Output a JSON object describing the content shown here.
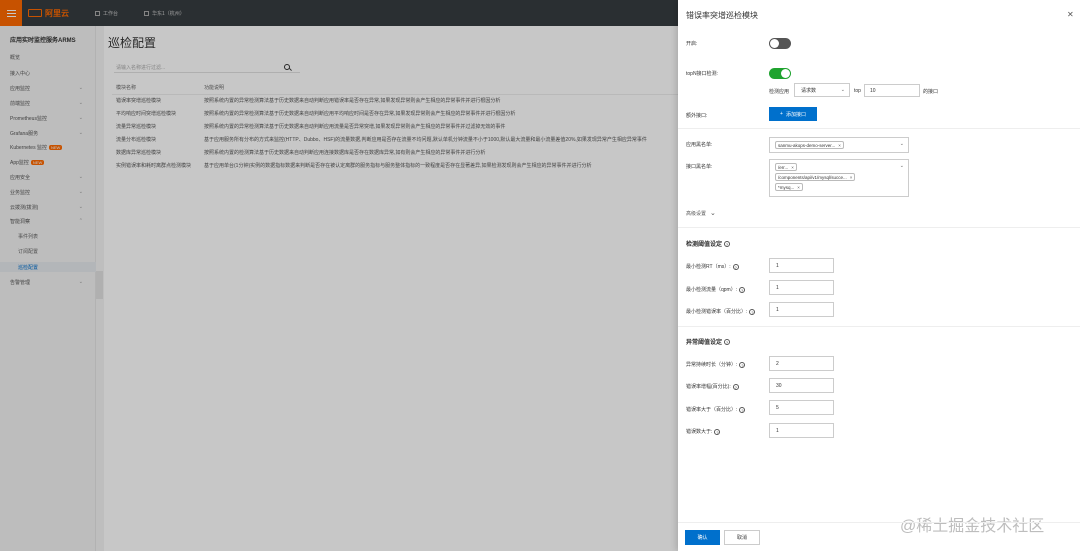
{
  "topbar": {
    "logo": "阿里云",
    "workbench": "工作台",
    "resource": "华东1（杭州）"
  },
  "sidebar": {
    "title": "应用实时监控服务ARMS",
    "items": [
      {
        "label": "概览"
      },
      {
        "label": "接入中心"
      },
      {
        "label": "应用监控"
      },
      {
        "label": "前端监控"
      },
      {
        "label": "Prometheus监控"
      },
      {
        "label": "Grafana服务"
      },
      {
        "label": "Kubernetes 监控",
        "badge": "NEW"
      },
      {
        "label": "App监控",
        "badge": "NEW"
      },
      {
        "label": "应用安全"
      },
      {
        "label": "业务监控"
      },
      {
        "label": "云拨测(拨测)"
      },
      {
        "label": "智能洞察"
      },
      {
        "label": "事件列表"
      },
      {
        "label": "订阅配置"
      },
      {
        "label": "巡检配置"
      },
      {
        "label": "告警管理"
      }
    ]
  },
  "main": {
    "title": "巡检配置",
    "search_placeholder": "请输入名称进行过滤...",
    "columns": [
      "模块名称",
      "功能说明"
    ],
    "rows": [
      {
        "name": "错误率突增巡检模块",
        "desc": "按照系统内置的异常检测算法基于历史数据来自动判断应用错误率是否存在异常,如果发现异常则会产生相应的异常事件并进行根因分析"
      },
      {
        "name": "平均响应时间突增巡检模块",
        "desc": "按照系统内置的异常检测算法基于历史数据来自动判断应用平均响应时间是否存在异常,如果发现异常则会产生相应的异常事件并进行根因分析"
      },
      {
        "name": "流量异常巡检模块",
        "desc": "按照系统内置的异常检测算法基于历史数据来自动判断应用流量是否异常突增,如果发现异常则会产生相应的异常事件并过滤掉无效的事件"
      },
      {
        "name": "流量分布巡检模块",
        "desc": "基于应用服务所有分布的方式来监控(HTTP、Dubbo、HSF)的流量数据,判断应用是否存在流量不均问题,默认单机分钟流量不小于1000,默认最大流量和最小流量差值20%,如果发现异常产生相应异常事件"
      },
      {
        "name": "数据库异常巡检模块",
        "desc": "按照系统内置的检测算法基于历史数据来自动判断应用连接数据库是否存在数据库异常,如有则会产生相应的异常事件并进行分析"
      },
      {
        "name": "实例错误率和耗时离群点检测模块",
        "desc": "基于应用单台(1分钟)实例的数据指标数据来判断是否存在被认定离群的服务指标与服务整体指标的一致程度是否存在显著差异,如果检测发现则会产生相应的异常事件并进行分析"
      }
    ]
  },
  "drawer": {
    "title": "错误率突增巡检模块",
    "enable_label": "开启:",
    "enable_on": false,
    "topn_label": "topN接口检测:",
    "topn_on": true,
    "detect_label": "检测应用",
    "detect_select": "请求数",
    "top_label": "top",
    "top_value": "10",
    "top_suffix": "的接口",
    "extra_label": "额外接口:",
    "add_button": "添加接口",
    "app_whitelist_label": "应用黑名单:",
    "app_tags": [
      "sanmu-akops-demo-server..."
    ],
    "api_whitelist_label": "接口黑名单:",
    "api_tags": [
      "/err...",
      "/components/api/v1/mysql/succe...",
      "*mysq..."
    ],
    "advanced": "高级设置",
    "detect_section": "检测阈值设定",
    "detect_fields": [
      {
        "label": "最小检测RT（ms）:",
        "value": "1"
      },
      {
        "label": "最小检测流量（qpm）:",
        "value": "1"
      },
      {
        "label": "最小检测错误率（百分比）:",
        "value": "1"
      }
    ],
    "anomaly_section": "异常阈值设定",
    "anomaly_fields": [
      {
        "label": "异常持续时长（分钟）:",
        "value": "2"
      },
      {
        "label": "错误率增幅(百分比):",
        "value": "30"
      },
      {
        "label": "错误率大于（百分比）:",
        "value": "5"
      },
      {
        "label": "错误数大于:",
        "value": "1"
      }
    ],
    "confirm": "确认",
    "cancel": "取消"
  },
  "watermark": "@稀土掘金技术社区",
  "colors": {
    "brand": "#ff6a00",
    "primary": "#0070cc",
    "switch_on": "#1fa32f"
  }
}
